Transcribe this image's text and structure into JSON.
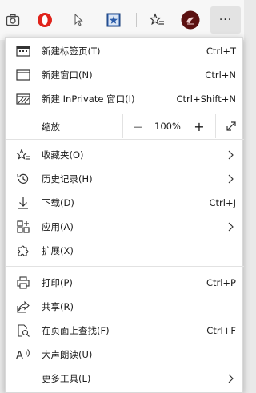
{
  "toolbar": {
    "icons": [
      "screenshot-icon",
      "opera-icon",
      "cursor-extension-icon",
      "star-extension-icon",
      "favorites-icon",
      "profile-avatar-icon",
      "more-icon"
    ],
    "more_label": "···"
  },
  "menu": {
    "new_tab": {
      "label": "新建标签页(T)",
      "shortcut": "Ctrl+T"
    },
    "new_window": {
      "label": "新建窗口(N)",
      "shortcut": "Ctrl+N"
    },
    "new_inprivate": {
      "label": "新建 InPrivate 窗口(I)",
      "shortcut": "Ctrl+Shift+N"
    },
    "zoom": {
      "label": "缩放",
      "minus": "—",
      "value": "100%",
      "plus": "+"
    },
    "favorites": {
      "label": "收藏夹(O)"
    },
    "history": {
      "label": "历史记录(H)"
    },
    "downloads": {
      "label": "下载(D)",
      "shortcut": "Ctrl+J"
    },
    "apps": {
      "label": "应用(A)"
    },
    "extensions": {
      "label": "扩展(X)"
    },
    "print": {
      "label": "打印(P)",
      "shortcut": "Ctrl+P"
    },
    "share": {
      "label": "共享(R)"
    },
    "find": {
      "label": "在页面上查找(F)",
      "shortcut": "Ctrl+F"
    },
    "read_aloud": {
      "label": "大声朗读(U)"
    },
    "more_tools": {
      "label": "更多工具(L)"
    }
  },
  "colors": {
    "avatar_bg": "#5a1010",
    "opera_red": "#e0231b",
    "star_ext_blue": "#2a5caa"
  }
}
